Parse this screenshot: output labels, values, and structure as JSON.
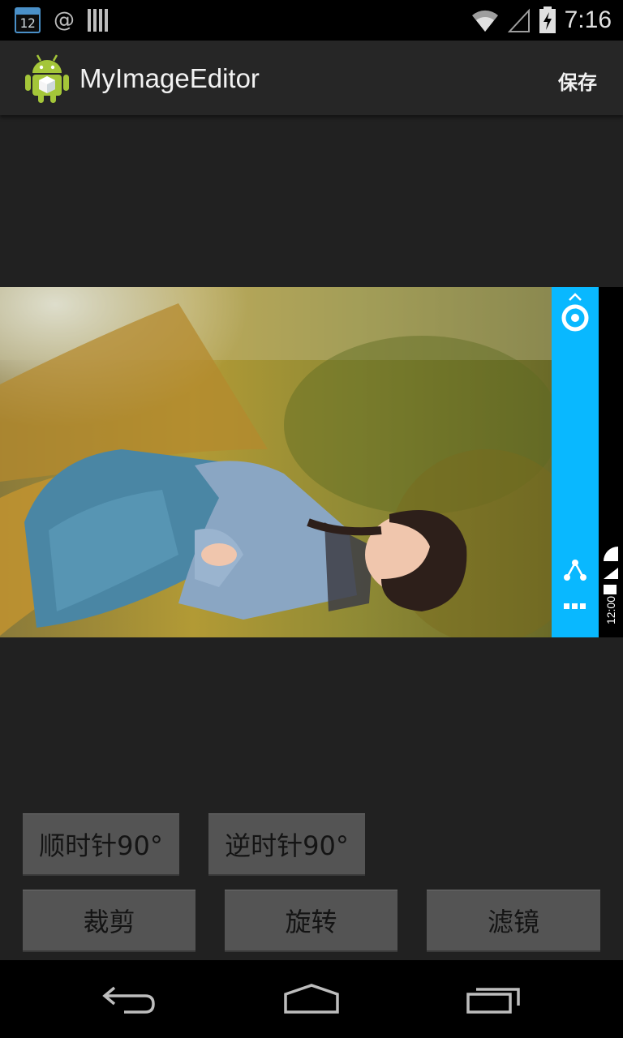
{
  "status_bar": {
    "calendar_day": "12",
    "at_symbol": "@",
    "time": "7:16",
    "icons": [
      "calendar-icon",
      "at-icon",
      "library-icon",
      "wifi-icon",
      "signal-icon",
      "battery-charging-icon"
    ]
  },
  "action_bar": {
    "title": "MyImageEditor",
    "save_label": "保存",
    "logo_icon": "android-logo-icon"
  },
  "image": {
    "description_icon": "rotated-photo",
    "side_panel_color": "#09b8ff",
    "side_panel_icons": [
      "chevron-up-icon",
      "app-swirl-icon",
      "share-icon",
      "more-dots-icon"
    ],
    "strip_time": "12:00"
  },
  "buttons": {
    "rotate_cw": "顺时针90°",
    "rotate_ccw": "逆时针90°",
    "crop": "裁剪",
    "rotate": "旋转",
    "filter": "滤镜"
  },
  "nav_bar": {
    "icons": [
      "back-icon",
      "home-icon",
      "recents-icon"
    ]
  }
}
